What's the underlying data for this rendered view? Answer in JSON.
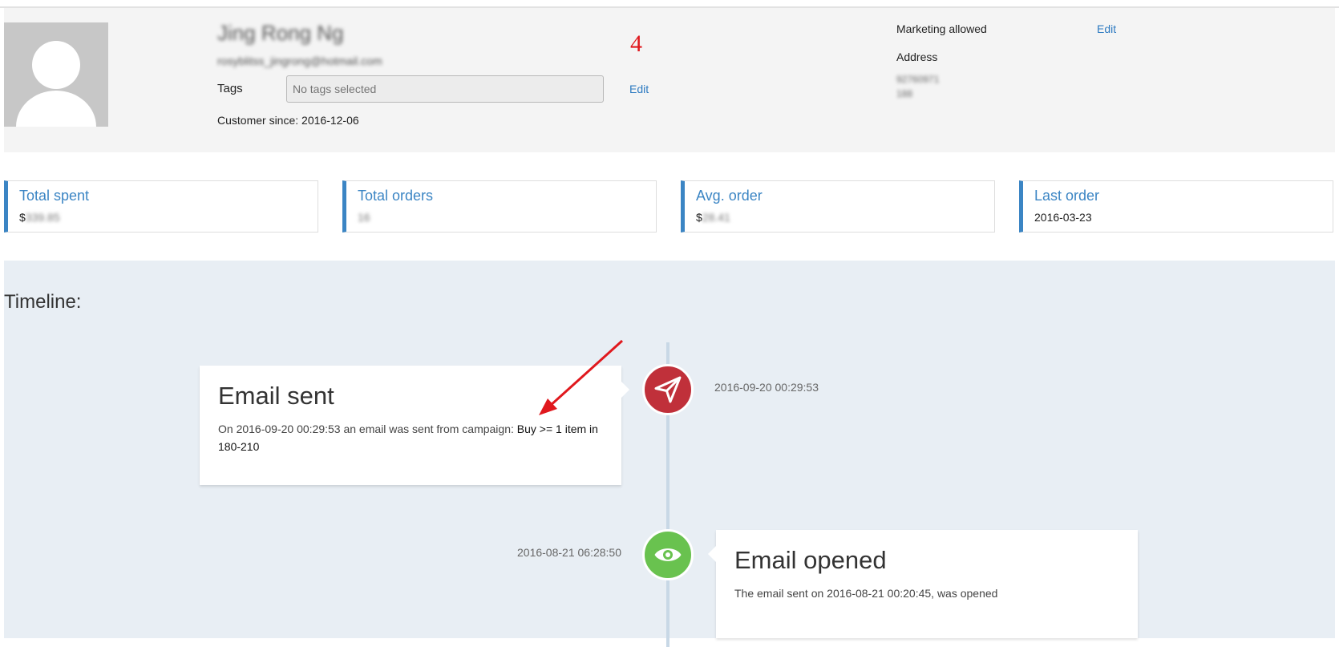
{
  "profile": {
    "name": "Jing Rong Ng",
    "email": "rosyblitss_jingrong@hotmail.com",
    "tags_label": "Tags",
    "tags_placeholder": "No tags selected",
    "tags_edit": "Edit",
    "customer_since_label": "Customer since:",
    "customer_since_value": "2016-12-06",
    "marketing_label": "Marketing allowed",
    "marketing_edit": "Edit",
    "address_label": "Address",
    "address_line1": "92760971",
    "address_line2": "188"
  },
  "stats": [
    {
      "title": "Total spent",
      "prefix": "$",
      "value": "339.85"
    },
    {
      "title": "Total orders",
      "prefix": "",
      "value": "16"
    },
    {
      "title": "Avg. order",
      "prefix": "$",
      "value": "28.41"
    },
    {
      "title": "Last order",
      "prefix": "",
      "value": "2016-03-23"
    }
  ],
  "timeline": {
    "title": "Timeline:",
    "events": [
      {
        "title": "Email sent",
        "desc_prefix": "On 2016-09-20 00:29:53 an email was sent from campaign:",
        "campaign": "Buy >= 1 item in 180-210",
        "date": "2016-09-20 00:29:53",
        "icon": "paper-plane-icon",
        "color": "#c0303a"
      },
      {
        "title": "Email opened",
        "desc": "The email sent on 2016-08-21 00:20:45, was opened",
        "date": "2016-08-21 06:28:50",
        "icon": "eye-icon",
        "color": "#69c24f"
      }
    ]
  },
  "annotation": {
    "number": "4",
    "color": "#e0181d"
  },
  "colors": {
    "accent": "#3b85c4",
    "link": "#2d7ac1",
    "timeline_bg": "#e8eef4"
  }
}
